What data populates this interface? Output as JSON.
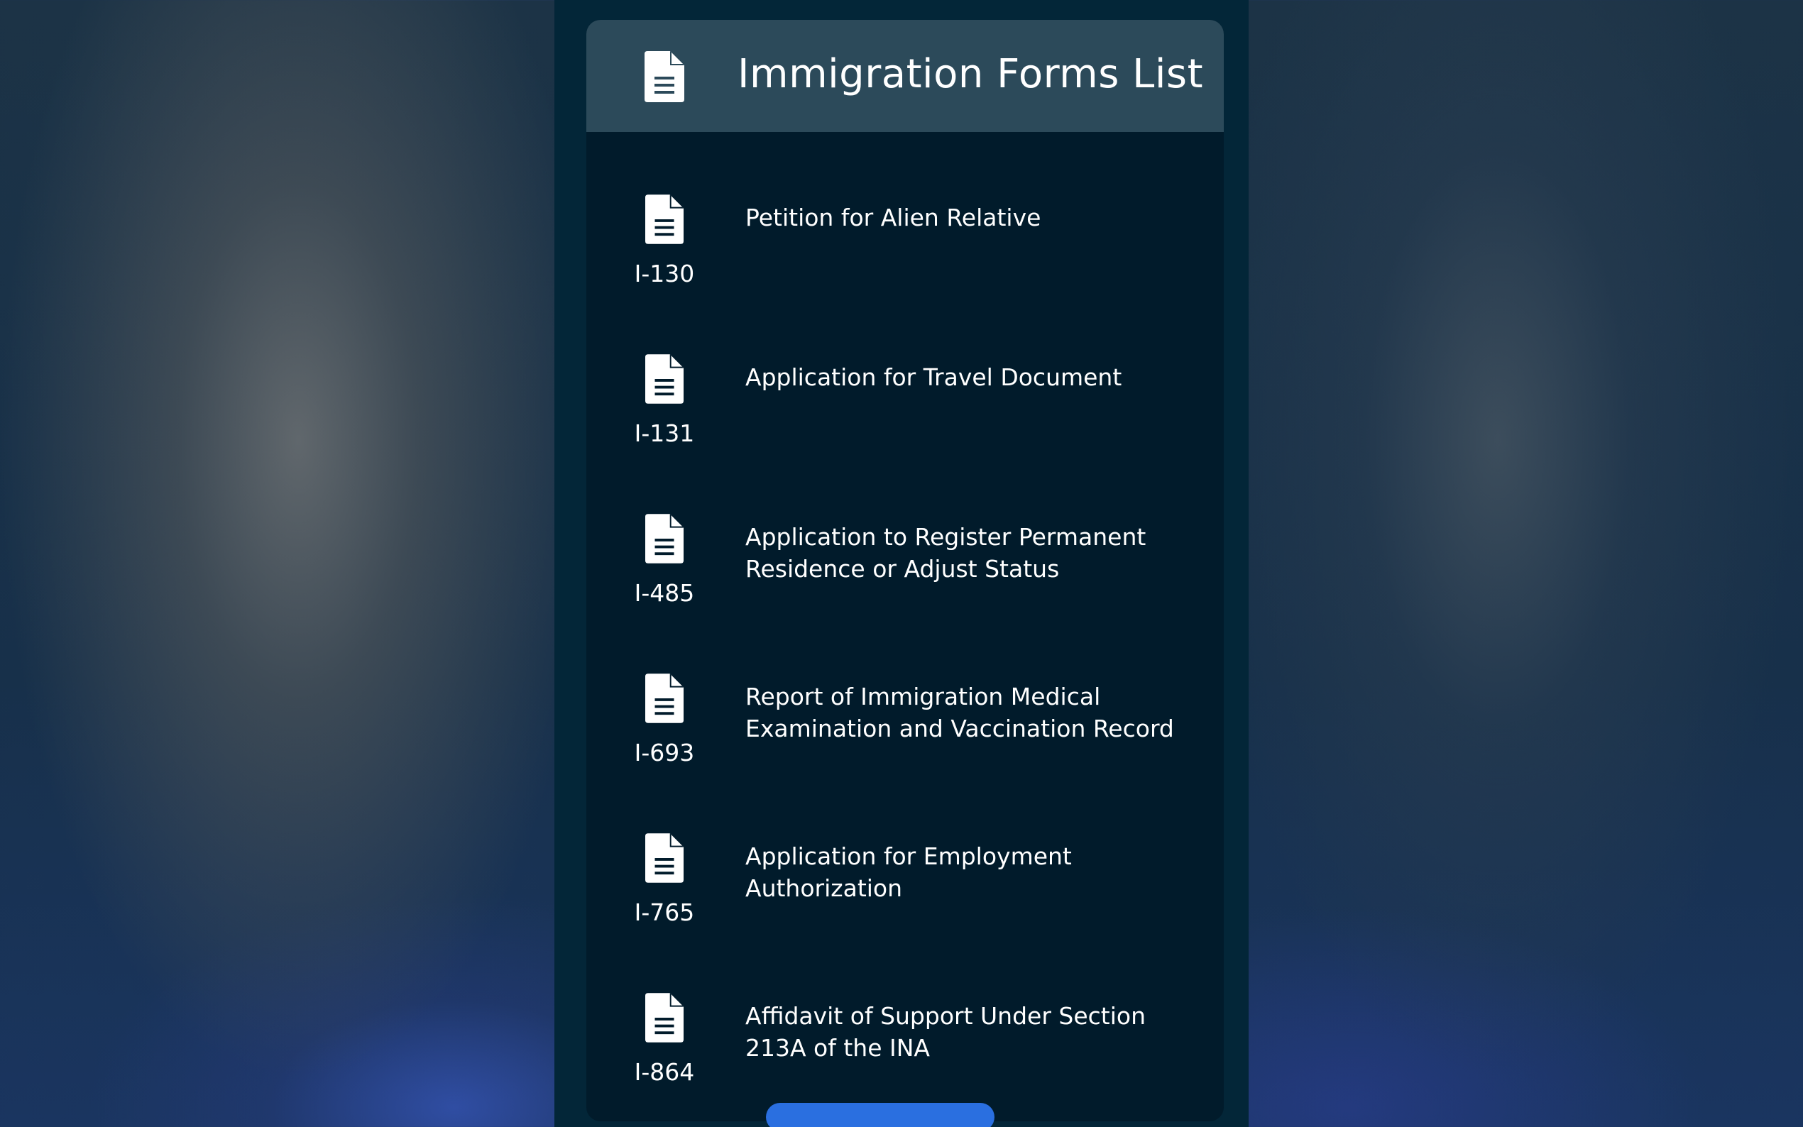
{
  "header": {
    "title": "Immigration Forms List",
    "icon": "document-icon"
  },
  "forms": [
    {
      "code": "I-130",
      "description": "Petition for Alien Relative"
    },
    {
      "code": "I-131",
      "description": "Application for Travel Document"
    },
    {
      "code": "I-485",
      "description": "Application to Register Permanent Residence or Adjust Status"
    },
    {
      "code": "I-693",
      "description": "Report of Immigration Medical Examination and Vaccination Record"
    },
    {
      "code": "I-765",
      "description": "Application for Employment Authorization"
    },
    {
      "code": "I-864",
      "description": "Affidavit of Support Under Section 213A of the INA"
    }
  ],
  "colors": {
    "header_bg": "#2c4a5a",
    "card_bg": "#011b2b",
    "text": "#ffffff",
    "accent": "#2a6fe0"
  }
}
